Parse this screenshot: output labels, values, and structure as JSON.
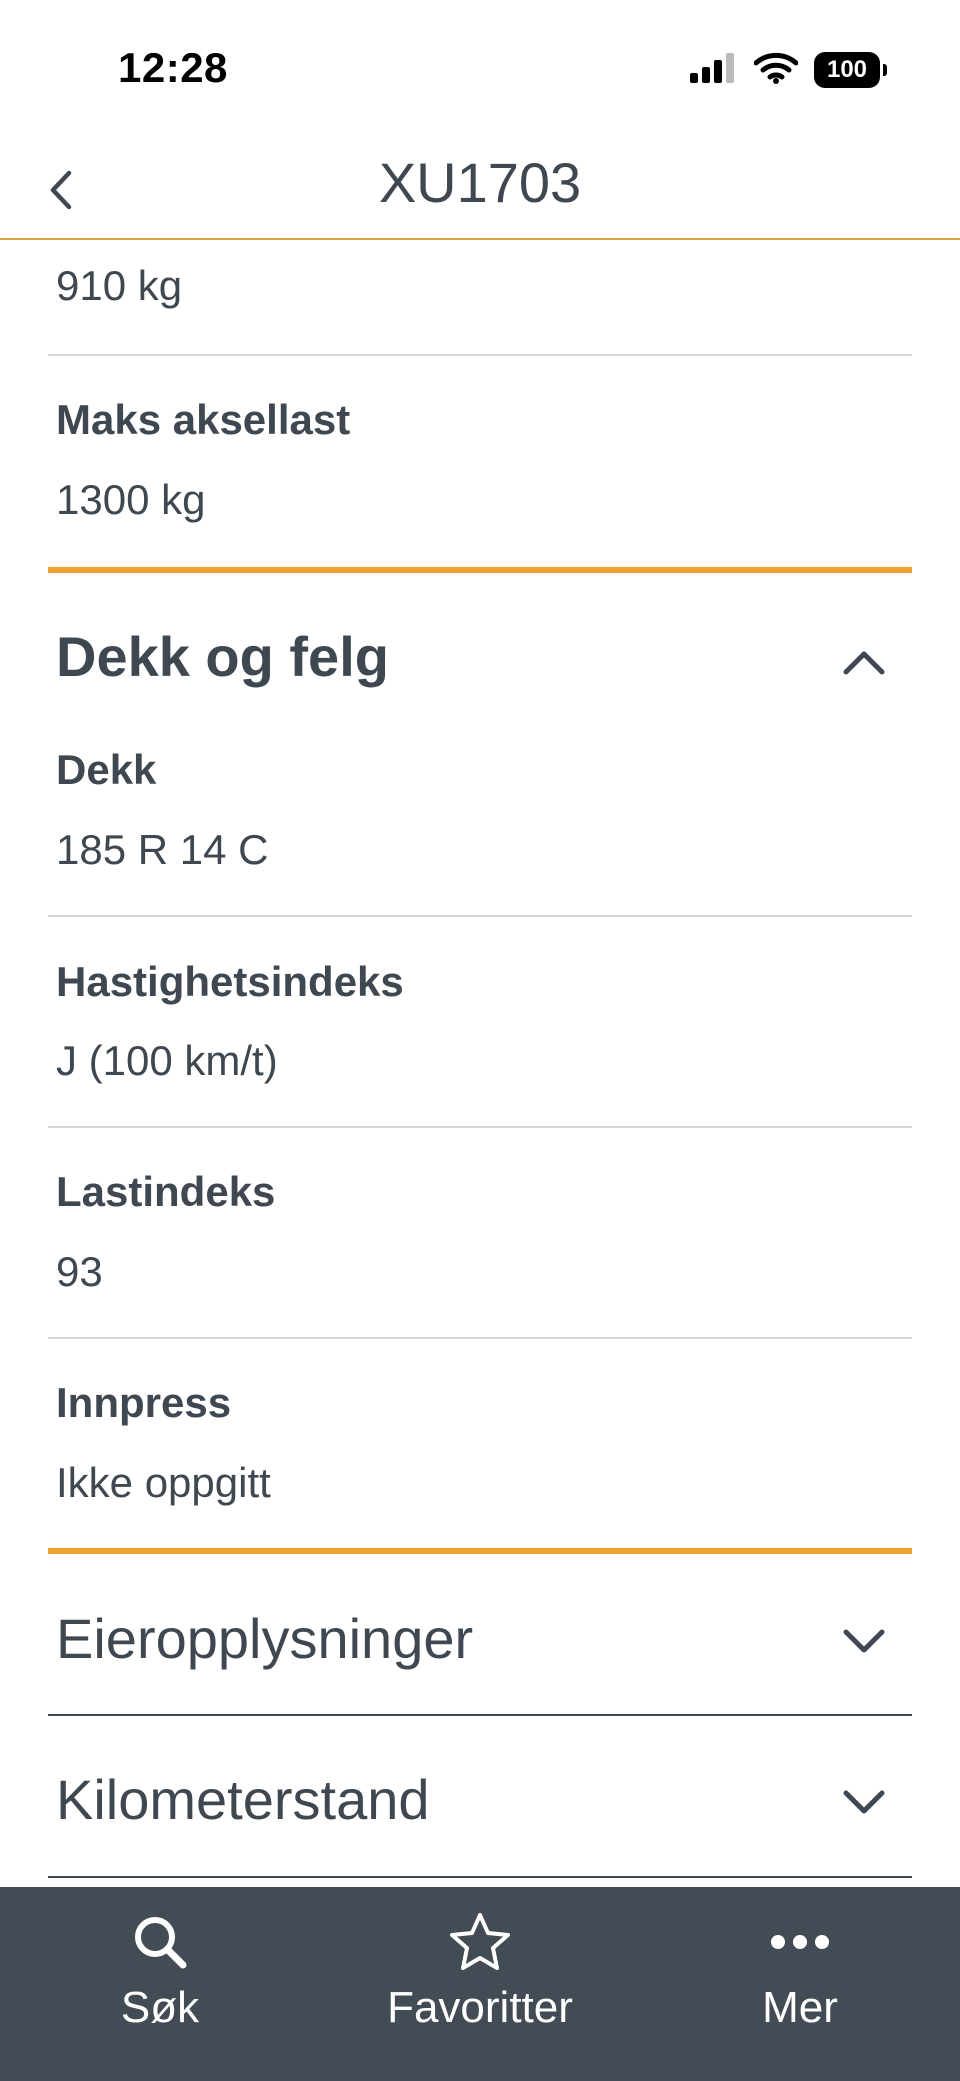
{
  "status_bar": {
    "time": "12:28",
    "battery": "100"
  },
  "nav": {
    "title": "XU1703"
  },
  "top_field": {
    "value": "910 kg"
  },
  "max_axle": {
    "label": "Maks aksellast",
    "value": "1300 kg"
  },
  "tires_section": {
    "title": "Dekk og felg",
    "expanded": true,
    "fields": [
      {
        "label": "Dekk",
        "value": "185 R 14 C"
      },
      {
        "label": "Hastighetsindeks",
        "value": "J (100  km/t)"
      },
      {
        "label": "Lastindeks",
        "value": "93"
      },
      {
        "label": "Innpress",
        "value": "Ikke oppgitt"
      }
    ]
  },
  "collapsed_sections": [
    {
      "title": "Eieropplysninger"
    },
    {
      "title": "Kilometerstand"
    }
  ],
  "tab_bar": {
    "tabs": [
      {
        "label": "Søk",
        "icon": "search-icon"
      },
      {
        "label": "Favoritter",
        "icon": "star-icon"
      },
      {
        "label": "Mer",
        "icon": "more-icon"
      }
    ]
  },
  "colors": {
    "accent": "#f0a132",
    "text": "#3f4850",
    "tab_bar": "#434c54"
  }
}
